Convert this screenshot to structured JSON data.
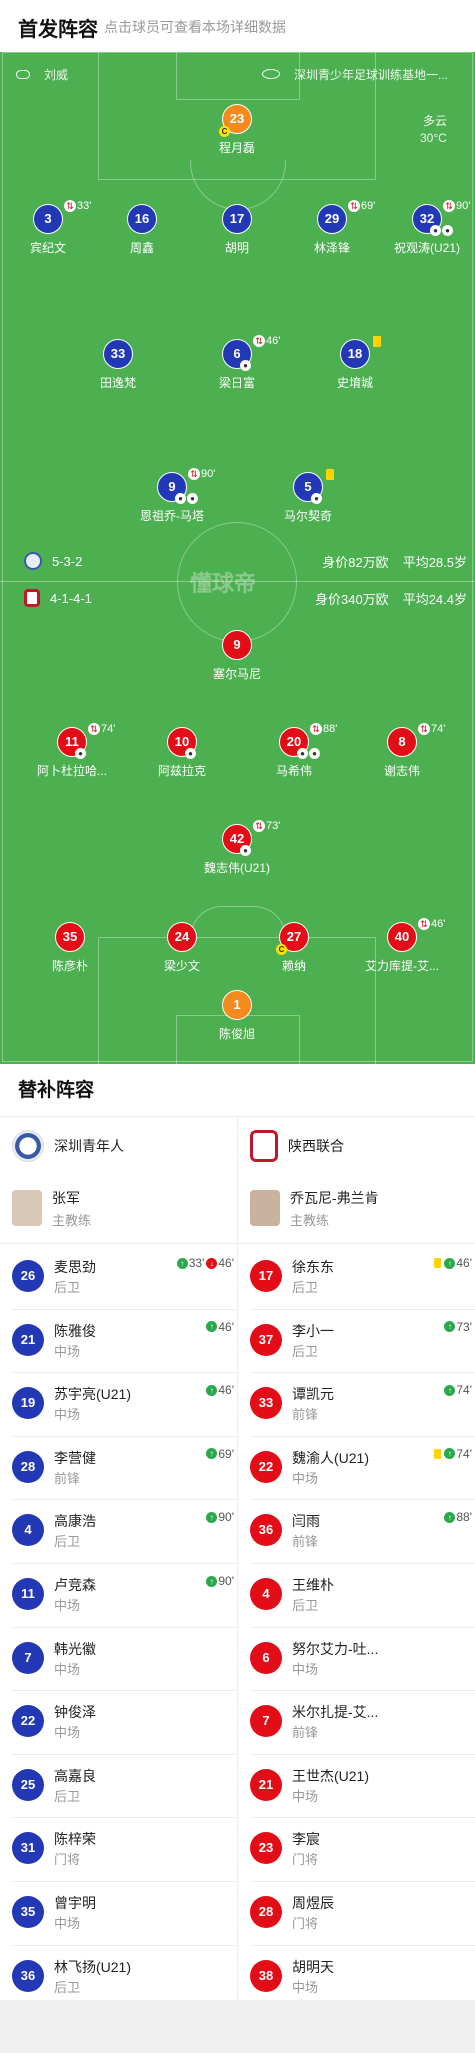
{
  "header": {
    "title": "首发阵容",
    "subtitle": "点击球员可查看本场详细数据"
  },
  "match_info": {
    "referee": "刘威",
    "venue": "深圳青少年足球训练基地一...",
    "weather": "多云",
    "temperature": "30°C"
  },
  "watermark": "懂球帝",
  "home_team": {
    "name": "深圳青年人",
    "formation": "5-3-2",
    "value": "身价82万欧",
    "avg_age": "平均28.5岁",
    "coach": "张军",
    "coach_role": "主教练"
  },
  "away_team": {
    "name": "陕西联合",
    "formation": "4-1-4-1",
    "value": "身价340万欧",
    "avg_age": "平均24.4岁",
    "coach": "乔瓦尼-弗兰肯",
    "coach_role": "主教练"
  },
  "pitch_players": [
    {
      "num": "23",
      "name": "程月磊",
      "side": "g",
      "captain": true
    },
    {
      "num": "3",
      "name": "宾纪文",
      "side": "h",
      "sub": "33'"
    },
    {
      "num": "16",
      "name": "周鑫",
      "side": "h"
    },
    {
      "num": "17",
      "name": "胡明",
      "side": "h"
    },
    {
      "num": "29",
      "name": "林泽锋",
      "side": "h",
      "sub": "69'"
    },
    {
      "num": "32",
      "name": "祝观涛(U21)",
      "side": "h",
      "sub": "90'",
      "events": 2
    },
    {
      "num": "33",
      "name": "田逸梵",
      "side": "h"
    },
    {
      "num": "6",
      "name": "梁日富",
      "side": "h",
      "sub": "46'",
      "events": 1
    },
    {
      "num": "18",
      "name": "史堉城",
      "side": "h",
      "yellow": true
    },
    {
      "num": "9",
      "name": "恩祖乔-马塔",
      "side": "h",
      "sub": "90'",
      "events": 2
    },
    {
      "num": "5",
      "name": "马尔契奇",
      "side": "h",
      "yellow": true,
      "events": 1
    },
    {
      "num": "9",
      "name": "塞尔马尼",
      "side": "a"
    },
    {
      "num": "11",
      "name": "阿卜杜拉哈...",
      "side": "a",
      "sub": "74'",
      "events": 1
    },
    {
      "num": "10",
      "name": "阿兹拉克",
      "side": "a",
      "events": 1
    },
    {
      "num": "20",
      "name": "马希伟",
      "side": "a",
      "sub": "88'",
      "events": 2
    },
    {
      "num": "8",
      "name": "谢志伟",
      "side": "a",
      "sub": "74'"
    },
    {
      "num": "42",
      "name": "魏志伟(U21)",
      "side": "a",
      "sub": "73'",
      "events": 1
    },
    {
      "num": "35",
      "name": "陈彦朴",
      "side": "a"
    },
    {
      "num": "24",
      "name": "梁少文",
      "side": "a"
    },
    {
      "num": "27",
      "name": "赖纳",
      "side": "a",
      "captain": true
    },
    {
      "num": "40",
      "name": "艾力库提-艾...",
      "side": "a",
      "sub": "46'"
    },
    {
      "num": "1",
      "name": "陈俊旭",
      "side": "g"
    }
  ],
  "subs_title": "替补阵容",
  "home_subs": [
    {
      "num": "26",
      "name": "麦思劲",
      "pos": "后卫",
      "in": "33'",
      "out": "46'"
    },
    {
      "num": "21",
      "name": "陈雅俊",
      "pos": "中场",
      "in": "46'"
    },
    {
      "num": "19",
      "name": "苏宇亮(U21)",
      "pos": "中场",
      "in": "46'"
    },
    {
      "num": "28",
      "name": "李营健",
      "pos": "前锋",
      "in": "69'"
    },
    {
      "num": "4",
      "name": "高康浩",
      "pos": "后卫",
      "in": "90'"
    },
    {
      "num": "11",
      "name": "卢竞森",
      "pos": "中场",
      "in": "90'"
    },
    {
      "num": "7",
      "name": "韩光徽",
      "pos": "中场"
    },
    {
      "num": "22",
      "name": "钟俊泽",
      "pos": "中场"
    },
    {
      "num": "25",
      "name": "高嘉良",
      "pos": "后卫"
    },
    {
      "num": "31",
      "name": "陈梓荣",
      "pos": "门将"
    },
    {
      "num": "35",
      "name": "曾宇明",
      "pos": "中场"
    },
    {
      "num": "36",
      "name": "林飞扬(U21)",
      "pos": "后卫"
    }
  ],
  "away_subs": [
    {
      "num": "17",
      "name": "徐东东",
      "pos": "后卫",
      "in": "46'",
      "yellow": true
    },
    {
      "num": "37",
      "name": "李小一",
      "pos": "后卫",
      "in": "73'"
    },
    {
      "num": "33",
      "name": "谭凯元",
      "pos": "前锋",
      "in": "74'"
    },
    {
      "num": "22",
      "name": "魏渝人(U21)",
      "pos": "中场",
      "in": "74'",
      "yellow": true
    },
    {
      "num": "36",
      "name": "闫雨",
      "pos": "前锋",
      "in": "88'"
    },
    {
      "num": "4",
      "name": "王维朴",
      "pos": "后卫"
    },
    {
      "num": "6",
      "name": "努尔艾力-吐...",
      "pos": "中场"
    },
    {
      "num": "7",
      "name": "米尔扎提-艾...",
      "pos": "前锋"
    },
    {
      "num": "21",
      "name": "王世杰(U21)",
      "pos": "中场"
    },
    {
      "num": "23",
      "name": "李宸",
      "pos": "门将"
    },
    {
      "num": "28",
      "name": "周煜辰",
      "pos": "门将"
    },
    {
      "num": "38",
      "name": "胡明天",
      "pos": "中场"
    }
  ]
}
